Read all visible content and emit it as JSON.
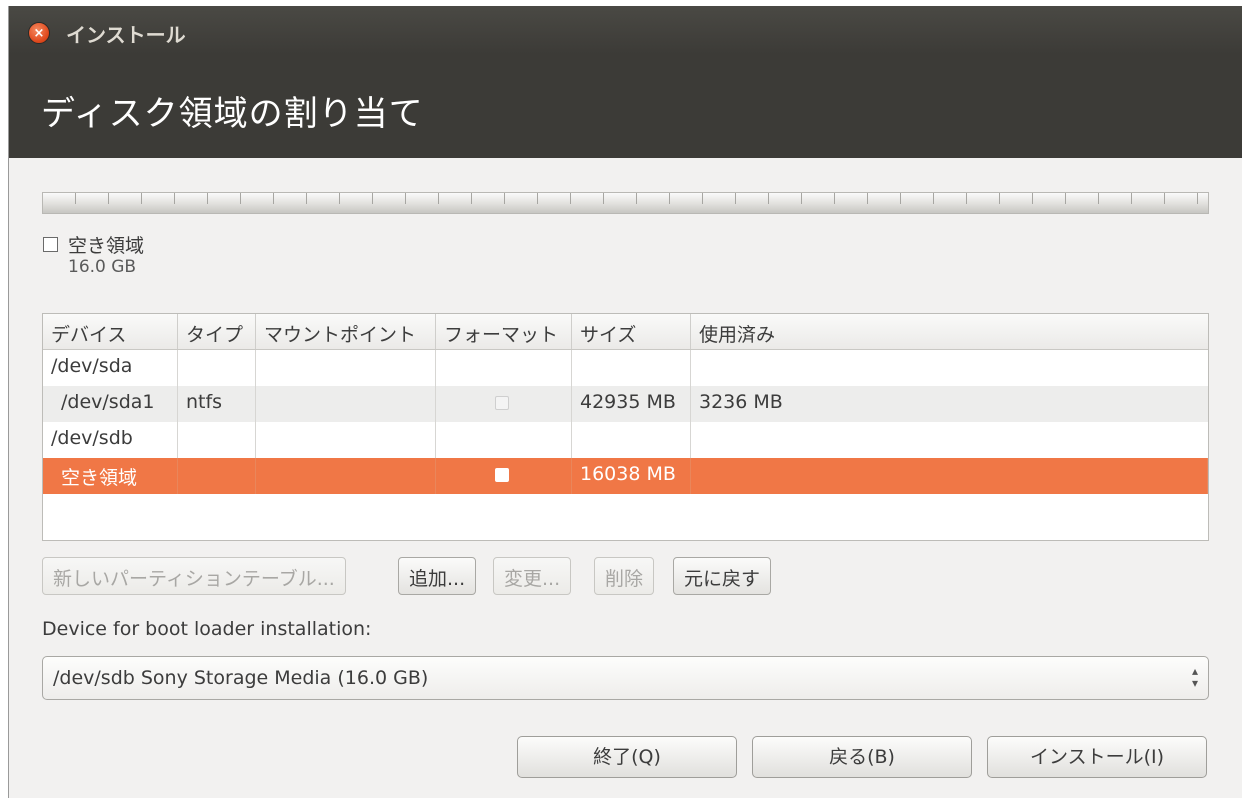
{
  "window": {
    "title": "インストール"
  },
  "header": {
    "title": "ディスク領域の割り当て"
  },
  "partition_bar": {
    "legend_label": "空き領域",
    "legend_size": "16.0 GB"
  },
  "table": {
    "columns": [
      "デバイス",
      "タイプ",
      "マウントポイント",
      "フォーマット",
      "サイズ",
      "使用済み"
    ],
    "rows": [
      {
        "device": "/dev/sda",
        "type": "",
        "mount": "",
        "size": "",
        "used": ""
      },
      {
        "device": " /dev/sda1",
        "type": "ntfs",
        "mount": "",
        "size": "42935 MB",
        "used": "3236 MB"
      },
      {
        "device": "/dev/sdb",
        "type": "",
        "mount": "",
        "size": "",
        "used": ""
      },
      {
        "device": "空き領域",
        "type": "",
        "mount": "",
        "size": "16038 MB",
        "used": ""
      }
    ]
  },
  "buttons": {
    "new_table": "新しいパーティションテーブル...",
    "add": "追加...",
    "change": "変更...",
    "delete": "削除",
    "revert": "元に戻す"
  },
  "boot_loader": {
    "label": "Device for boot loader installation:",
    "selected": "/dev/sdb Sony Storage Media (16.0 GB)"
  },
  "dialog_buttons": {
    "quit": "終了(Q)",
    "back": "戻る(B)",
    "install": "インストール(I)"
  }
}
